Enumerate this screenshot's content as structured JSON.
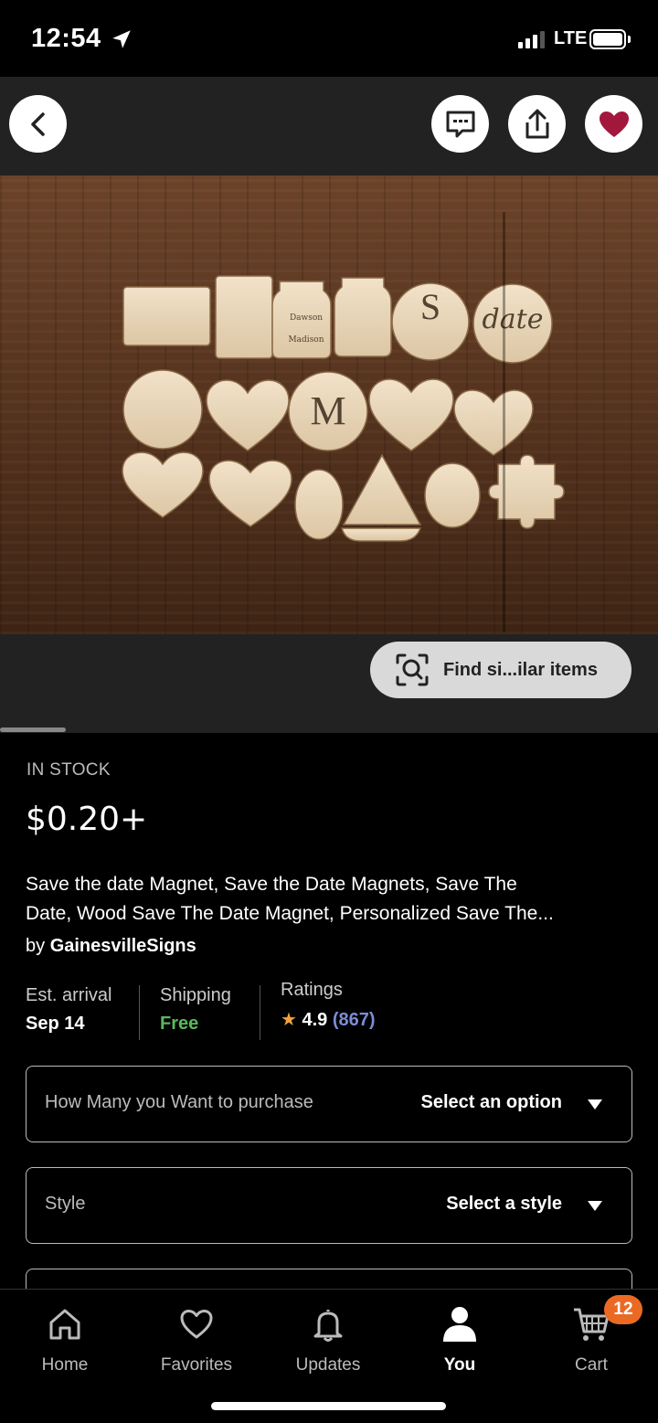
{
  "status_bar": {
    "time": "12:54",
    "network": "LTE"
  },
  "image": {
    "find_similar_label": "Find si...ilar items"
  },
  "product": {
    "stock": "IN STOCK",
    "price": "$0.20+",
    "title_line1": "Save the date Magnet, Save the Date Magnets, Save The",
    "title_line2": "Date, Wood Save The Date Magnet, Personalized Save The...",
    "by": "by",
    "seller": "GainesvilleSigns"
  },
  "meta": {
    "arrival_label": "Est. arrival",
    "arrival_value": "Sep 14",
    "shipping_label": "Shipping",
    "shipping_value": "Free",
    "ratings_label": "Ratings",
    "rating_value": "4.9",
    "rating_count": "(867)"
  },
  "options": [
    {
      "label": "How Many you Want to purchase",
      "value": "Select an option"
    },
    {
      "label": "Style",
      "value": "Select a style"
    }
  ],
  "tabs": [
    {
      "label": "Home",
      "icon": "home-icon"
    },
    {
      "label": "Favorites",
      "icon": "heart-icon"
    },
    {
      "label": "Updates",
      "icon": "bell-icon"
    },
    {
      "label": "You",
      "icon": "person-icon"
    },
    {
      "label": "Cart",
      "icon": "cart-icon"
    }
  ],
  "cart_badge": "12",
  "colors": {
    "favorite_heart": "#a3173d",
    "free_green": "#5cb85c",
    "rating_star": "#f1a33c",
    "rating_count": "#7b8dd8",
    "cart_badge": "#ea6a24"
  }
}
